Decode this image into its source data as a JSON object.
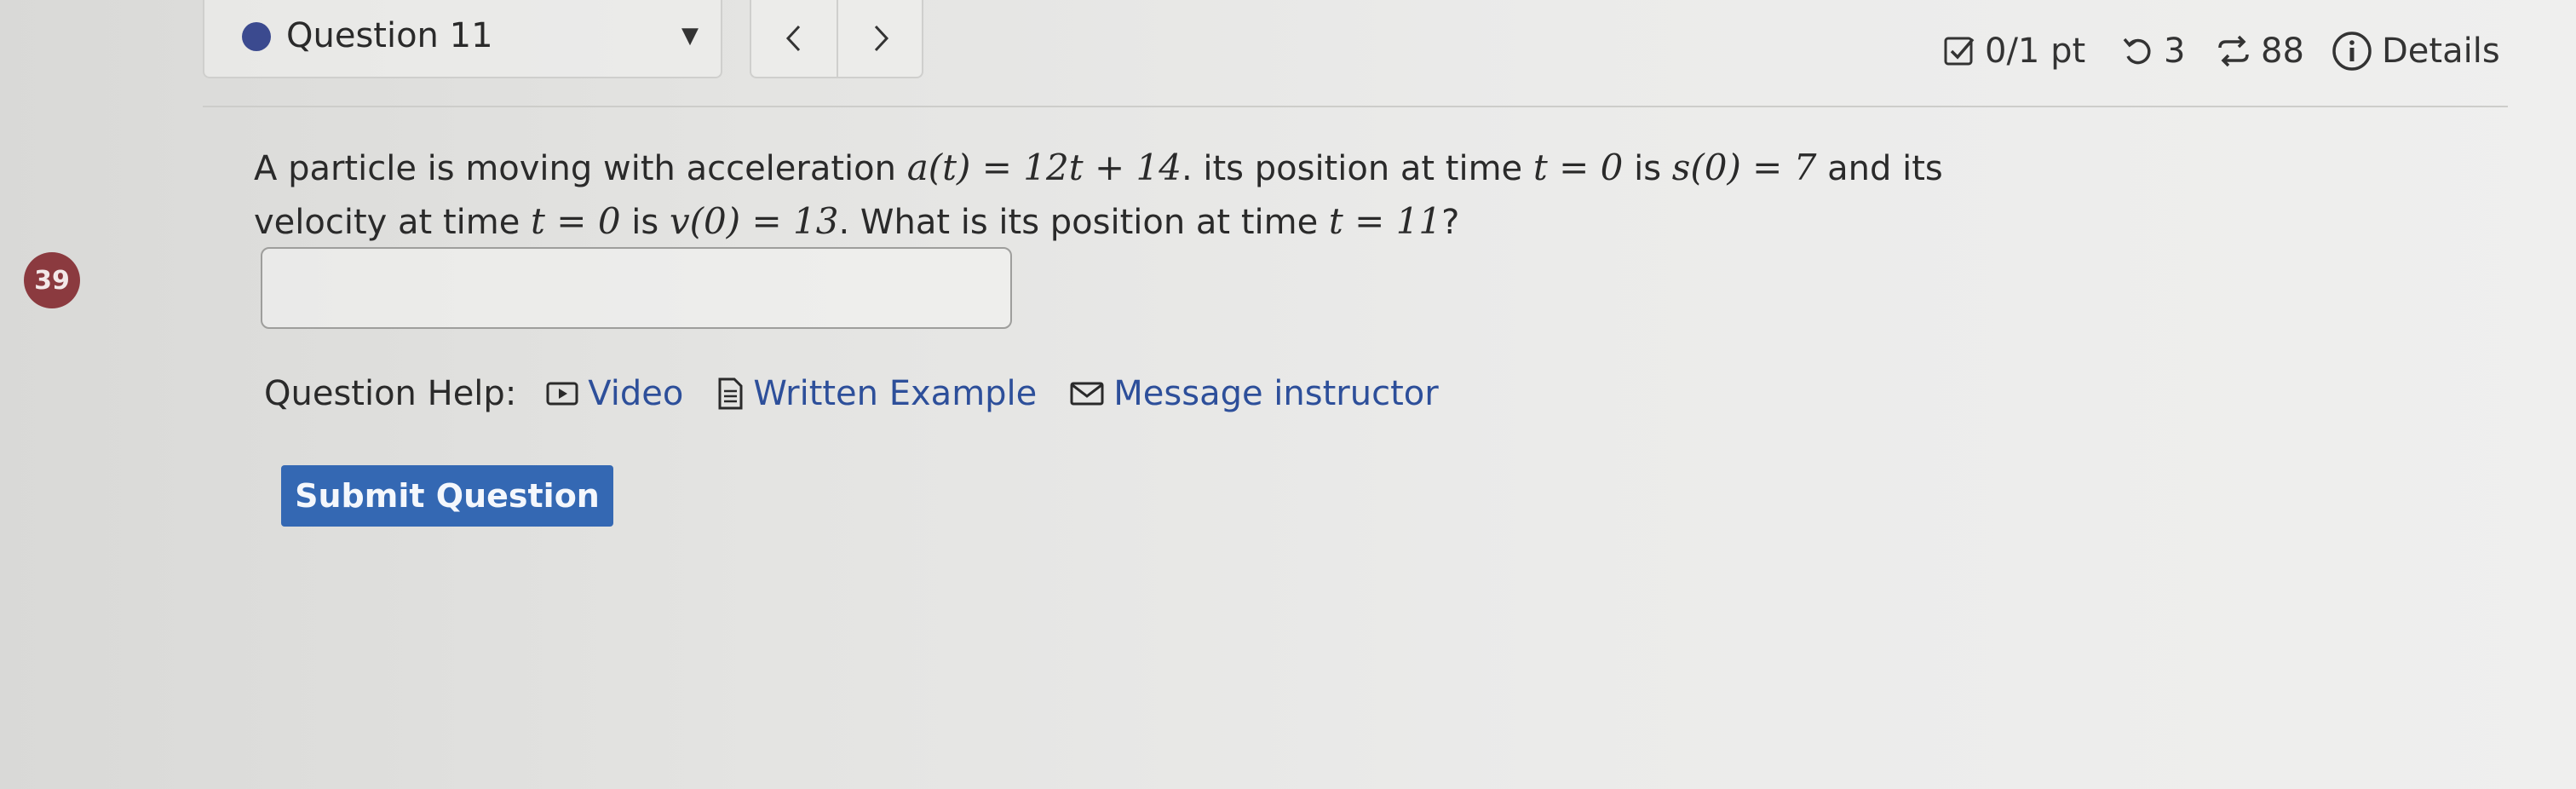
{
  "header": {
    "question_label": "Question 11",
    "points": "0/1 pt",
    "retries": "3",
    "attempts": "88",
    "details_label": "Details"
  },
  "question_number": "39",
  "problem": {
    "p1": "A particle is moving with acceleration ",
    "m1": "a(t) = 12t + 14",
    "p2": ". its position at time ",
    "m2": "t = 0",
    "p3": " is ",
    "m3": "s(0) = 7",
    "p4": " and its velocity at time ",
    "m4": "t = 0",
    "p5": " is ",
    "m5": "v(0) = 13",
    "p6": ". What is its position at time ",
    "m6": "t = 11",
    "p7": "?"
  },
  "answer": {
    "value": ""
  },
  "help": {
    "label": "Question Help:",
    "video": "Video",
    "written_example": "Written Example",
    "message_instructor": "Message instructor"
  },
  "submit_label": "Submit Question",
  "colors": {
    "accent_blue": "#3468b3",
    "link_blue": "#2d4f9a",
    "question_dot": "#3b4a8f",
    "number_badge": "#8b3a3f"
  }
}
